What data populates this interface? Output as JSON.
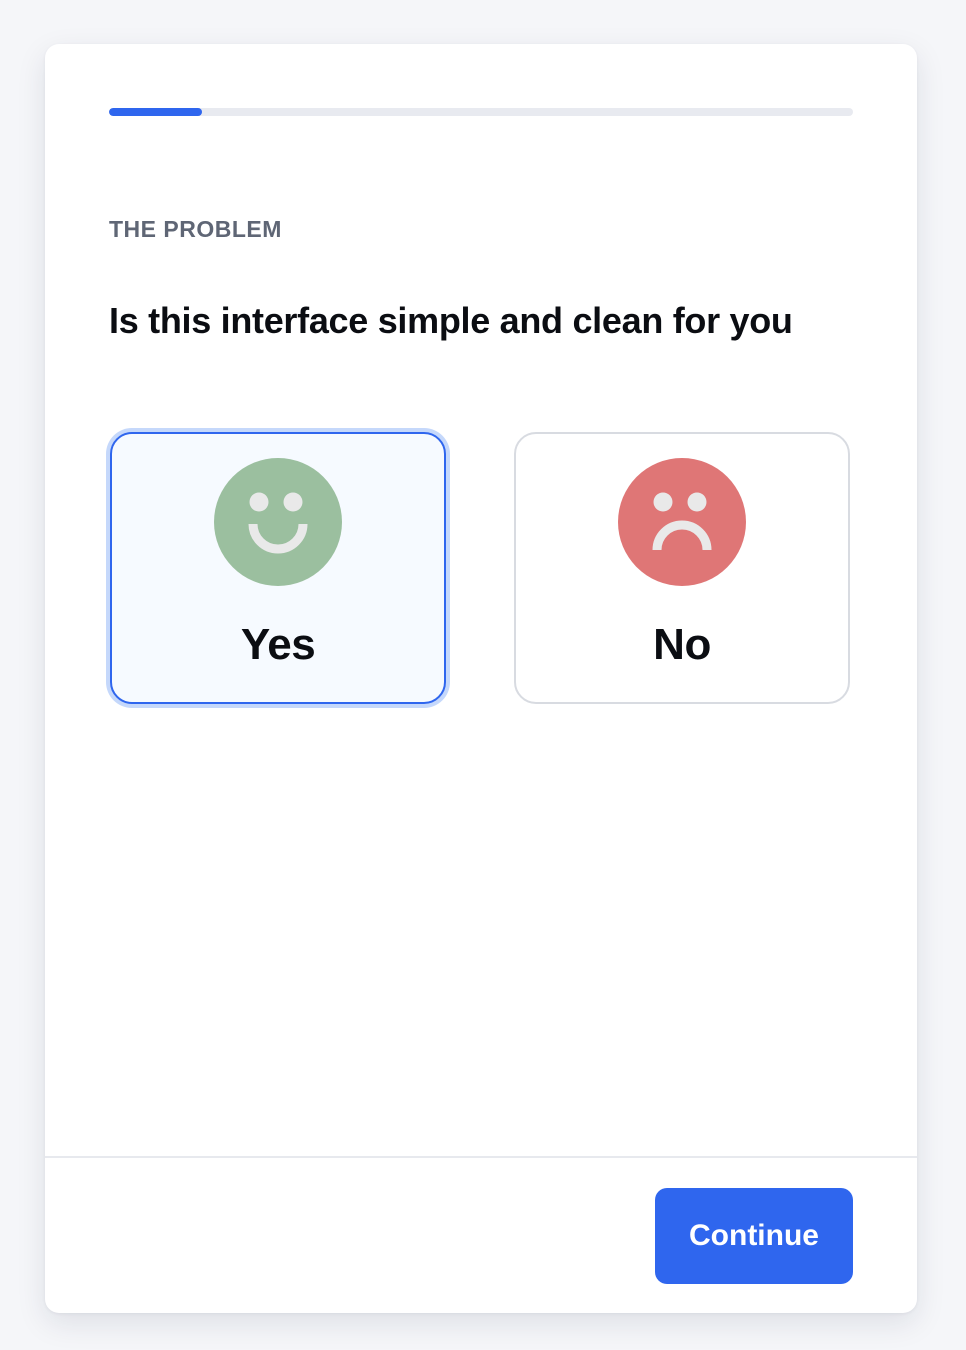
{
  "progress": {
    "fraction": 0.125,
    "fill_color": "#2f66ee",
    "track_color": "#e8eaf0"
  },
  "eyebrow": "THE PROBLEM",
  "question": "Is this interface simple and clean for you",
  "options": [
    {
      "label": "Yes",
      "icon": "smiley-face-icon",
      "face_color": "#9bbf9f",
      "selected": true
    },
    {
      "label": "No",
      "icon": "sad-face-icon",
      "face_color": "#df7676",
      "selected": false
    }
  ],
  "footer": {
    "continue_label": "Continue",
    "button_color": "#2f66ee"
  }
}
